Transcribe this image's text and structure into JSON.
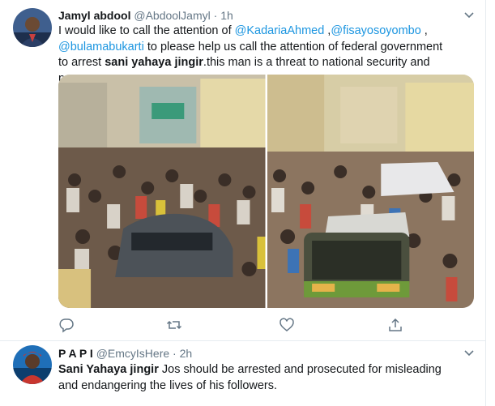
{
  "tweets": [
    {
      "name": "Jamyl abdool",
      "handle": "@AbdoolJamyl",
      "separator": "·",
      "time": "1h",
      "text": {
        "part1": "I would like to call the attention of ",
        "mention1": "@KadariaAhmed",
        "part2": " ,",
        "mention2": "@fisayosoyombo",
        "part3": " ,",
        "mention3": "@bulamabukarti",
        "part4": " to please help us call the attention of federal government to arrest ",
        "bold": "sani yahaya jingir",
        "part5": ".this man is a threat to national security and peace."
      },
      "media": [
        {
          "alt_icon": "crowd-photo-left"
        },
        {
          "alt_icon": "crowd-photo-right"
        }
      ],
      "actions": [
        "reply-icon",
        "retweet-icon",
        "like-icon",
        "share-icon"
      ]
    },
    {
      "name": "P A P I",
      "handle": "@EmcyIsHere",
      "separator": "·",
      "time": "2h",
      "text": {
        "bold": "Sani Yahaya jingir",
        "rest": " Jos should be arrested and prosecuted for misleading and endangering the lives of his followers."
      }
    }
  ],
  "colors": {
    "link": "#1b95e0",
    "muted": "#657786",
    "text": "#14171a",
    "divider": "#e6ecf0"
  }
}
